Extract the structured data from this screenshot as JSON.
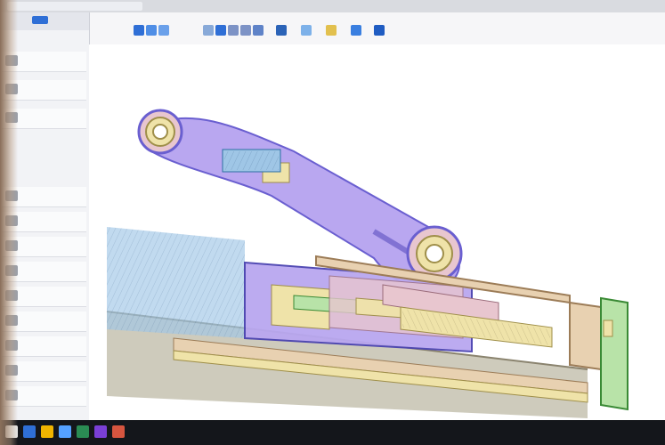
{
  "app": {
    "window_title": "",
    "accent": "#2f6fd6"
  },
  "tabs": [
    {
      "label": ""
    },
    {
      "label": ""
    }
  ],
  "ribbon": {
    "menus": [
      "",
      "",
      "",
      "",
      "",
      "",
      "",
      ""
    ]
  },
  "browser": {
    "items": [
      {
        "label": ""
      },
      {
        "label": ""
      },
      {
        "label": ""
      },
      {
        "label": ""
      },
      {
        "label": ""
      },
      {
        "label": ""
      },
      {
        "label": ""
      },
      {
        "label": ""
      },
      {
        "label": ""
      },
      {
        "label": ""
      },
      {
        "label": ""
      },
      {
        "label": ""
      },
      {
        "label": ""
      },
      {
        "label": ""
      },
      {
        "label": ""
      }
    ]
  },
  "colors": {
    "part_blue": "#9fc6e6",
    "part_violet": "#b9a7f0",
    "part_yellow": "#efe3a9",
    "part_pink": "#e8c6cf",
    "part_tan": "#e8d1b1",
    "part_green": "#b8e3a8",
    "part_gray": "#c9c5b5"
  }
}
